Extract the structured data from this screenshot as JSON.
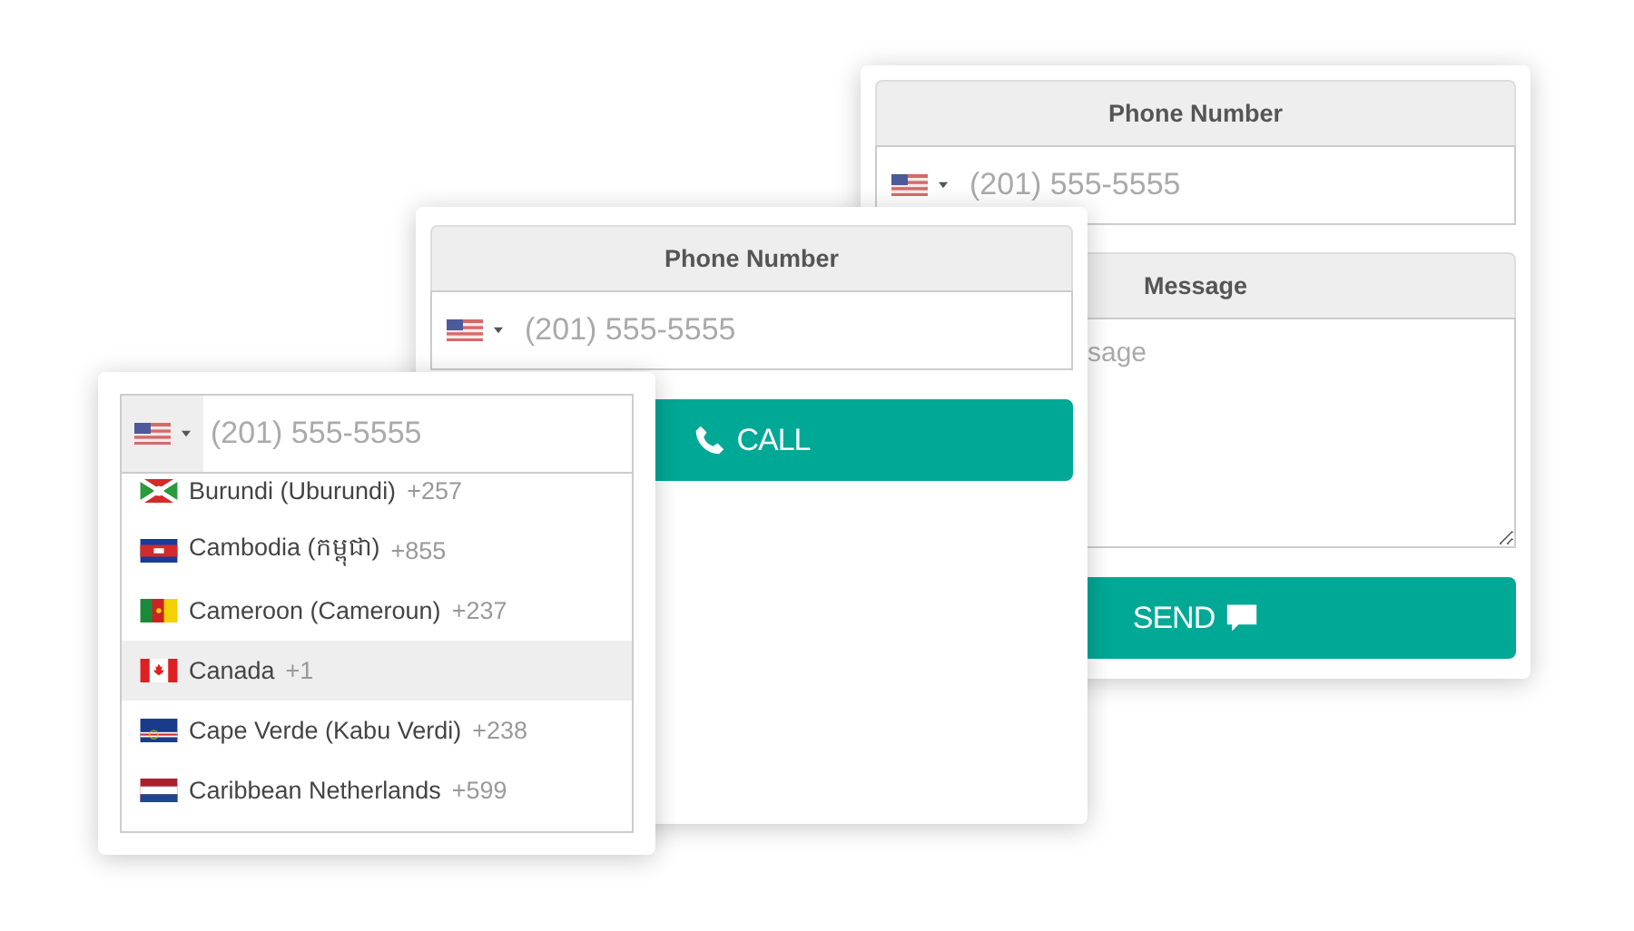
{
  "sms_form": {
    "phone_label": "Phone Number",
    "phone_placeholder": "(201) 555-5555",
    "message_label": "Message",
    "message_placeholder": "sage",
    "send_button": "SEND"
  },
  "call_form": {
    "phone_label": "Phone Number",
    "phone_placeholder": "(201) 555-5555",
    "call_button": "CALL"
  },
  "country_picker": {
    "phone_placeholder": "(201) 555-5555",
    "countries": [
      {
        "name": "Burundi (Uburundi)",
        "code": "+257",
        "kind": "bi",
        "selected": false
      },
      {
        "name": "Cambodia (កម្ពុជា)",
        "code": "+855",
        "kind": "kh",
        "selected": false
      },
      {
        "name": "Cameroon (Cameroun)",
        "code": "+237",
        "kind": "cm",
        "selected": false
      },
      {
        "name": "Canada",
        "code": "+1",
        "kind": "ca",
        "selected": true
      },
      {
        "name": "Cape Verde (Kabu Verdi)",
        "code": "+238",
        "kind": "cv",
        "selected": false
      },
      {
        "name": "Caribbean Netherlands",
        "code": "+599",
        "kind": "bq",
        "selected": false
      }
    ]
  }
}
